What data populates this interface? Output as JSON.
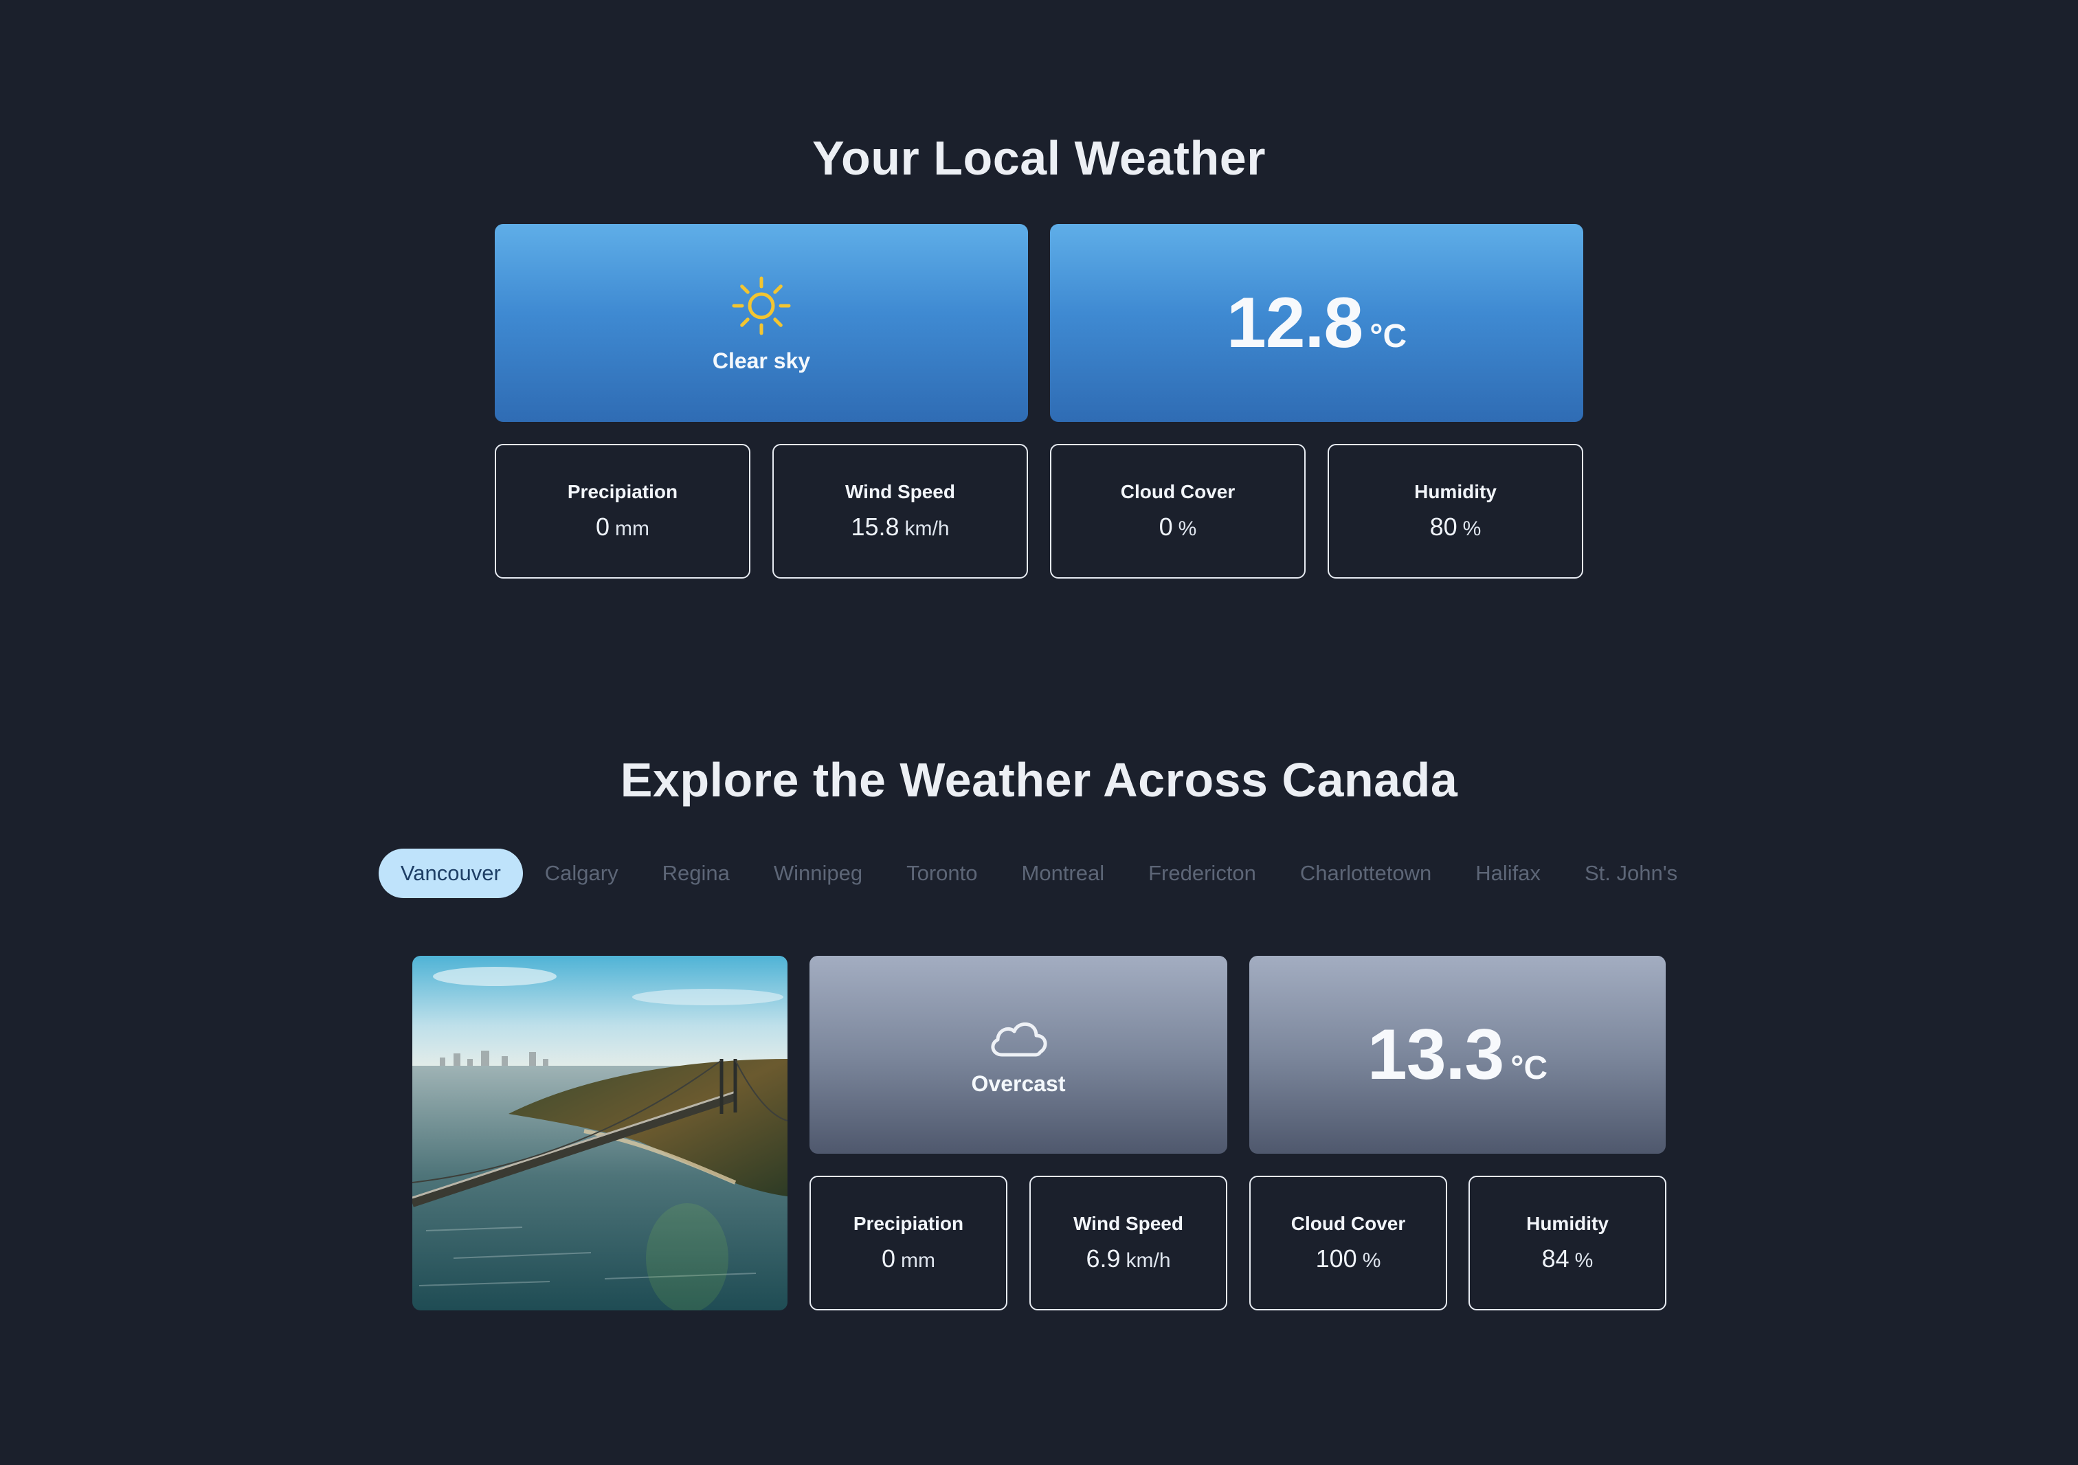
{
  "local": {
    "title": "Your Local Weather",
    "condition": "Clear sky",
    "condition_icon": "sun-icon",
    "temperature": "12.8",
    "temp_unit": "°C",
    "stats": [
      {
        "title": "Precipiation",
        "value": "0",
        "unit": "mm"
      },
      {
        "title": "Wind Speed",
        "value": "15.8",
        "unit": "km/h"
      },
      {
        "title": "Cloud Cover",
        "value": "0",
        "unit": "%"
      },
      {
        "title": "Humidity",
        "value": "80",
        "unit": "%"
      }
    ]
  },
  "explore": {
    "title": "Explore the Weather Across Canada",
    "cities": [
      "Vancouver",
      "Calgary",
      "Regina",
      "Winnipeg",
      "Toronto",
      "Montreal",
      "Fredericton",
      "Charlottetown",
      "Halifax",
      "St. John's"
    ],
    "active_city": "Vancouver",
    "condition": "Overcast",
    "condition_icon": "cloud-icon",
    "temperature": "13.3",
    "temp_unit": "°C",
    "stats": [
      {
        "title": "Precipiation",
        "value": "0",
        "unit": "mm"
      },
      {
        "title": "Wind Speed",
        "value": "6.9",
        "unit": "km/h"
      },
      {
        "title": "Cloud Cover",
        "value": "100",
        "unit": "%"
      },
      {
        "title": "Humidity",
        "value": "84",
        "unit": "%"
      }
    ]
  },
  "colors": {
    "background": "#1b202c",
    "local_card": "#3f8ad2",
    "overcast_card": "#7c879c",
    "active_tab": "#bfe3fb",
    "sun": "#f2c531"
  }
}
